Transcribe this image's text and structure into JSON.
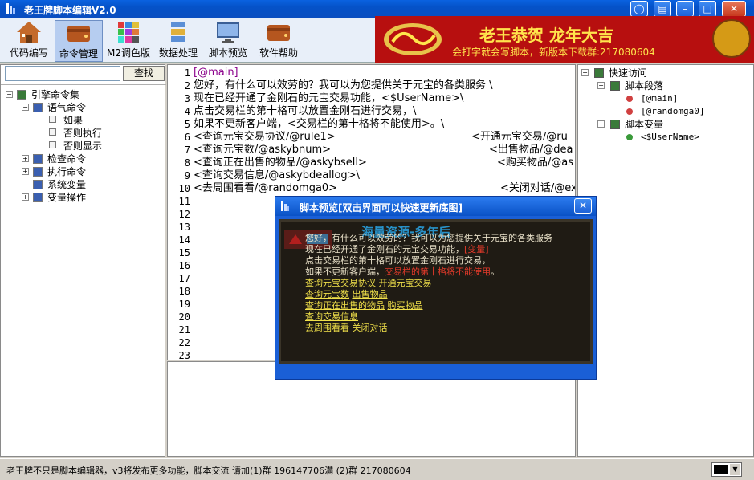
{
  "window": {
    "title": "老王牌脚本编辑V2.0",
    "controls": [
      "◯",
      "▤",
      "–",
      "□",
      "✕"
    ]
  },
  "toolbar": {
    "items": [
      {
        "label": "代码编写",
        "icon": "house-icon"
      },
      {
        "label": "命令管理",
        "icon": "wallet-icon"
      },
      {
        "label": "M2调色版",
        "icon": "palette-icon"
      },
      {
        "label": "数据处理",
        "icon": "database-icon"
      },
      {
        "label": "脚本预览",
        "icon": "monitor-icon"
      },
      {
        "label": "软件帮助",
        "icon": "help-icon"
      }
    ],
    "banner": {
      "line1": "老王恭贺 龙年大吉",
      "line2": "会打字就会写脚本，新版本下载群:217080604"
    }
  },
  "search": {
    "button": "查找",
    "value": ""
  },
  "command_tree": [
    {
      "label": "引擎命令集",
      "level": 0,
      "expander": "−"
    },
    {
      "label": "语气命令",
      "level": 1,
      "expander": "−"
    },
    {
      "label": "如果",
      "level": 2,
      "expander": ""
    },
    {
      "label": "否则执行",
      "level": 2,
      "expander": ""
    },
    {
      "label": "否则显示",
      "level": 2,
      "expander": ""
    },
    {
      "label": "检查命令",
      "level": 1,
      "expander": "+"
    },
    {
      "label": "执行命令",
      "level": 1,
      "expander": "+"
    },
    {
      "label": "系统变量",
      "level": 1,
      "expander": ""
    },
    {
      "label": "变量操作",
      "level": 1,
      "expander": "+"
    }
  ],
  "editor": {
    "line_numbers": [
      "1",
      "2",
      "3",
      "4",
      "5",
      "6",
      "7",
      "8",
      "9",
      "10",
      "11",
      "12",
      "13",
      "14",
      "15",
      "16",
      "17",
      "18",
      "19",
      "20",
      "21",
      "22",
      "23"
    ],
    "lines": [
      {
        "left": "[@main]",
        "right": ""
      },
      {
        "left": "您好，有什么可以效劳的？我可以为您提供关于元宝的各类服务 \\",
        "right": ""
      },
      {
        "left": "现在已经开通了金刚石的元宝交易功能，<$UserName>\\",
        "right": ""
      },
      {
        "left": "点击交易栏的第十格可以放置金刚石进行交易，\\",
        "right": ""
      },
      {
        "left": "如果不更新客户端，<交易栏的第十格将不能使用>。\\",
        "right": ""
      },
      {
        "left": "<查询元宝交易协议/@rule1>",
        "right": "<开通元宝交易/@ru"
      },
      {
        "left": "<查询元宝数/@askybnum>",
        "right": "<出售物品/@dea"
      },
      {
        "left": "<查询正在出售的物品/@askybsell>",
        "right": "<购买物品/@as"
      },
      {
        "left": "<查询交易信息/@askybdeallog>\\",
        "right": ""
      },
      {
        "left": "<去周围看看/@randomga0>",
        "right": "<关闭对话/@ex"
      }
    ]
  },
  "quick_access": [
    {
      "label": "快速访问",
      "level": 0,
      "expander": "−"
    },
    {
      "label": "脚本段落",
      "level": 1,
      "expander": "−"
    },
    {
      "label": "[@main]",
      "level": 2,
      "expander": ""
    },
    {
      "label": "[@randomga0]",
      "level": 2,
      "expander": ""
    },
    {
      "label": "脚本变量",
      "level": 1,
      "expander": "−"
    },
    {
      "label": "<$UserName>",
      "level": 2,
      "expander": ""
    }
  ],
  "preview": {
    "title": "脚本预览[双击界面可以快速更新底图]",
    "close": "✕",
    "watermark": "海量资源-多年后",
    "lines": [
      {
        "text": "您好，有什么可以效劳的？我可以为您提供关于元宝的各类服务"
      },
      {
        "text": "现在已经开通了金刚石的元宝交易功能，",
        "red": "[变量]"
      },
      {
        "text": "点击交易栏的第十格可以放置金刚石进行交易，"
      },
      {
        "text": "如果不更新客户端，",
        "red": "交易栏的第十格将不能使用",
        "tail": "。"
      },
      {
        "link": "查询元宝交易协议",
        "link2": "开通元宝交易"
      },
      {
        "link": "查询元宝数",
        "link2": "出售物品"
      },
      {
        "link": "查询正在出售的物品",
        "link2": "购买物品"
      },
      {
        "link": "查询交易信息",
        "link2": ""
      },
      {
        "link": "去周围看看",
        "link2": "关闭对话"
      }
    ]
  },
  "statusbar": {
    "text": "老王牌不只是脚本编辑器，v3将发布更多功能，脚本交流 请加(1)群 196147706满  (2)群 217080604"
  },
  "colors": {
    "tag": "#8b008b",
    "link": "#f0e04a",
    "red": "#e23a2a"
  }
}
